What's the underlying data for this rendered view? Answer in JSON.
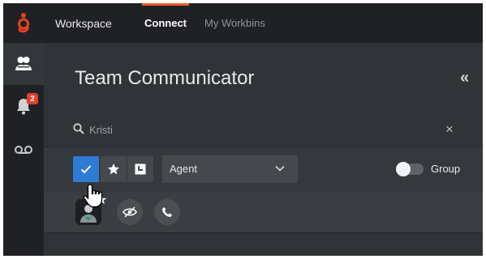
{
  "topbar": {
    "nav": {
      "workspace": "Workspace",
      "connect": "Connect",
      "workbins": "My Workbins"
    }
  },
  "sidebar": {
    "notifications_badge": "2"
  },
  "panel": {
    "title": "Team Communicator",
    "collapse_glyph": "«",
    "search": {
      "value": "Kristi",
      "clear_glyph": "×"
    },
    "filters": {
      "type_selected": "Agent",
      "group_label": "Group",
      "group_toggle_on": false
    }
  },
  "colors": {
    "accent": "#f15a22",
    "primary_blue": "#2e7bd6",
    "badge": "#e0402c"
  }
}
